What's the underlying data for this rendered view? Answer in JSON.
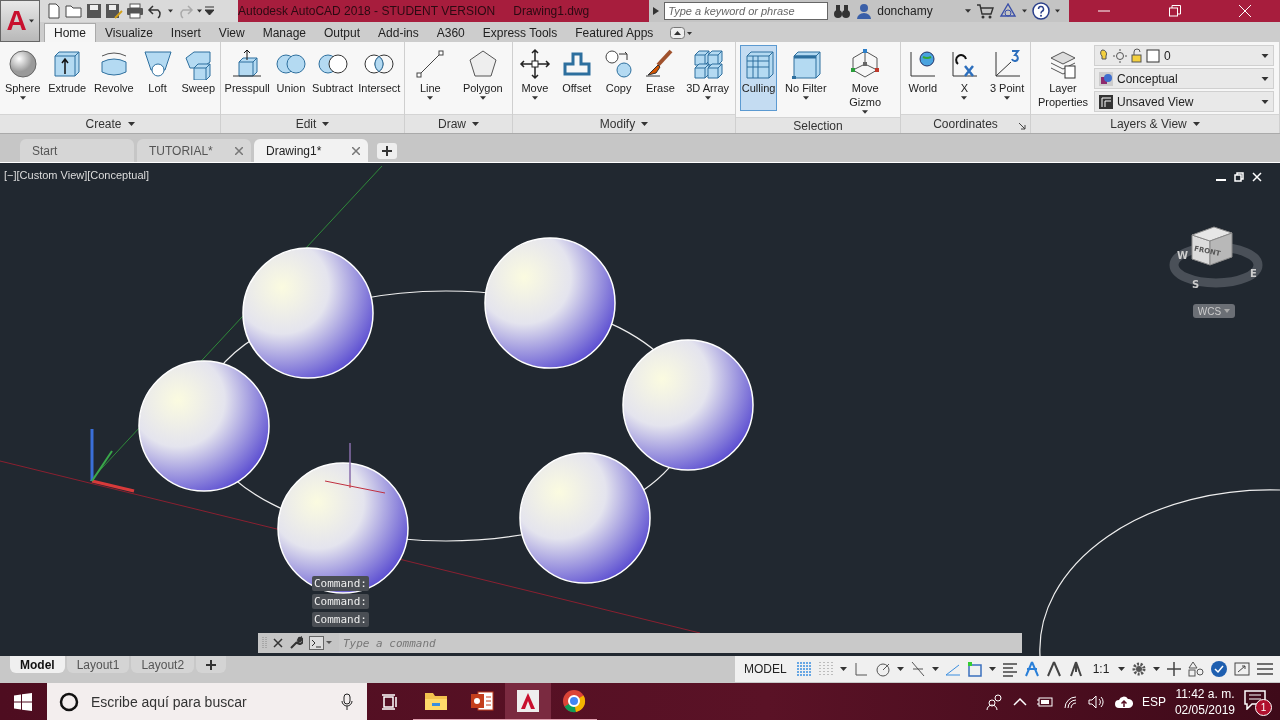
{
  "app_menu": {
    "logo": "A"
  },
  "title_bar": {
    "title": "Autodesk AutoCAD 2018 - STUDENT VERSION",
    "file": "Drawing1.dwg",
    "search": {
      "placeholder": "Type a keyword or phrase"
    },
    "user": "donchamy"
  },
  "ribbon_tabs": [
    {
      "label": "Home",
      "selected": true
    },
    {
      "label": "Visualize",
      "selected": false
    },
    {
      "label": "Insert",
      "selected": false
    },
    {
      "label": "View",
      "selected": false
    },
    {
      "label": "Manage",
      "selected": false
    },
    {
      "label": "Output",
      "selected": false
    },
    {
      "label": "Add-ins",
      "selected": false
    },
    {
      "label": "A360",
      "selected": false
    },
    {
      "label": "Express Tools",
      "selected": false
    },
    {
      "label": "Featured Apps",
      "selected": false
    }
  ],
  "ribbon_panels": [
    {
      "title": "Create",
      "caret": true,
      "launcher": false,
      "tools": [
        {
          "label": "Sphere",
          "dropdown": true,
          "on": false
        },
        {
          "label": "Extrude",
          "dropdown": false,
          "on": false
        },
        {
          "label": "Revolve",
          "dropdown": false,
          "on": false
        },
        {
          "label": "Loft",
          "dropdown": false,
          "on": false
        },
        {
          "label": "Sweep",
          "dropdown": false,
          "on": false
        }
      ]
    },
    {
      "title": "Edit",
      "caret": true,
      "launcher": false,
      "tools": [
        {
          "label": "Presspull",
          "dropdown": false,
          "on": false
        },
        {
          "label": "Union",
          "dropdown": false,
          "on": false
        },
        {
          "label": "Subtract",
          "dropdown": false,
          "on": false
        },
        {
          "label": "Intersect",
          "dropdown": false,
          "on": false
        }
      ]
    },
    {
      "title": "Draw",
      "caret": true,
      "launcher": false,
      "tools": [
        {
          "label": "Line",
          "dropdown": true,
          "on": false
        },
        {
          "label": "Polygon",
          "dropdown": true,
          "on": false
        }
      ]
    },
    {
      "title": "Modify",
      "caret": true,
      "launcher": false,
      "tools": [
        {
          "label": "Move",
          "dropdown": true,
          "on": false
        },
        {
          "label": "Offset",
          "dropdown": false,
          "on": false
        },
        {
          "label": "Copy",
          "dropdown": false,
          "on": false
        },
        {
          "label": "Erase",
          "dropdown": false,
          "on": false
        },
        {
          "label": "3D Array",
          "dropdown": true,
          "on": false
        }
      ]
    },
    {
      "title": "Selection",
      "caret": false,
      "launcher": false,
      "tools": [
        {
          "label": "Culling",
          "dropdown": false,
          "on": true
        },
        {
          "label": "No Filter",
          "dropdown": true,
          "on": false
        },
        {
          "label": "Move Gizmo",
          "dropdown": true,
          "on": false
        }
      ]
    },
    {
      "title": "Coordinates",
      "caret": false,
      "launcher": true,
      "tools": [
        {
          "label": "World",
          "dropdown": false,
          "on": false
        },
        {
          "label": "X",
          "dropdown": true,
          "on": false
        },
        {
          "label": "3 Point",
          "dropdown": true,
          "on": false
        }
      ]
    },
    {
      "title": "Layers & View",
      "caret": true,
      "launcher": false,
      "tools": [
        {
          "label": "Layer Properties",
          "dropdown": false,
          "on": false
        }
      ],
      "dropdowns": [
        {
          "kind": "layer",
          "text": "0"
        },
        {
          "kind": "style",
          "text": "Conceptual"
        },
        {
          "kind": "view",
          "text": "Unsaved View"
        }
      ]
    }
  ],
  "file_tabs": [
    {
      "label": "Start",
      "selected": false,
      "closable": false
    },
    {
      "label": "TUTORIAL*",
      "selected": false,
      "closable": true
    },
    {
      "label": "Drawing1*",
      "selected": true,
      "closable": true
    }
  ],
  "viewport": {
    "label": "[−][Custom View][Conceptual]",
    "viewcube": {
      "face": "FRONT",
      "compass": [
        "W",
        "S",
        "E"
      ],
      "ucs": "WCS"
    },
    "command_history": [
      "Command:",
      "Command:",
      "Command:"
    ],
    "command_line": {
      "placeholder": "Type a command"
    }
  },
  "layout_tabs": [
    {
      "label": "Model",
      "selected": true
    },
    {
      "label": "Layout1",
      "selected": false
    },
    {
      "label": "Layout2",
      "selected": false
    }
  ],
  "status_bar": {
    "space": "MODEL",
    "scale": "1:1"
  },
  "taskbar": {
    "search": {
      "placeholder": "Escribe aquí para buscar"
    },
    "apps": [
      {
        "kind": "folder",
        "selected": false
      },
      {
        "kind": "slides",
        "selected": false
      },
      {
        "kind": "cad",
        "selected": true
      },
      {
        "kind": "browser",
        "selected": false
      }
    ],
    "language": "ESP",
    "time": "11:42 a. m.",
    "date": "02/05/2019",
    "notifications": "1"
  }
}
